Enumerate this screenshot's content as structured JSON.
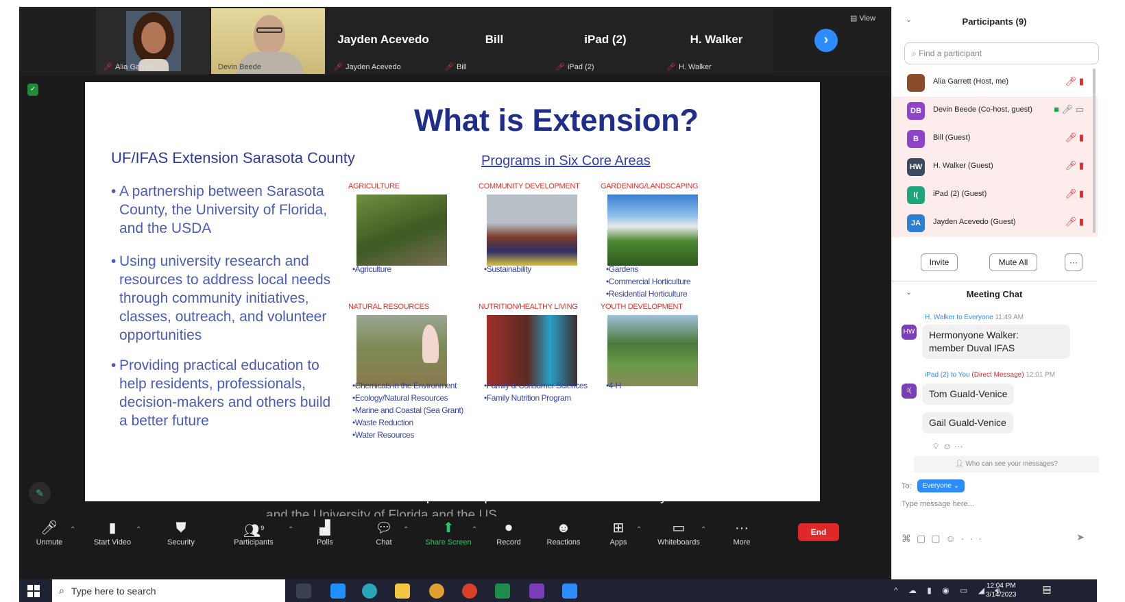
{
  "strip": {
    "tiles": [
      {
        "label": "Alia Garrett",
        "name": ""
      },
      {
        "label": "Devin Beede",
        "name": ""
      },
      {
        "label": "Jayden Acevedo",
        "name": "Jayden Acevedo"
      },
      {
        "label": "Bill",
        "name": "Bill"
      },
      {
        "label": "iPad (2)",
        "name": "iPad (2)"
      },
      {
        "label": "H. Walker",
        "name": "H. Walker"
      }
    ],
    "view_label": "View"
  },
  "slide": {
    "title": "What is Extension?",
    "subtitle": "UF/IFAS Extension Sarasota County",
    "programs_link": "Programs in Six Core Areas",
    "bullets": [
      "A partnership between Sarasota County, the University of Florida, and the USDA",
      "Using university research and resources to address local needs through community initiatives, classes, outreach, and volunteer opportunities",
      "Providing practical education to help residents, professionals, decision-makers and others build a better future"
    ],
    "areas": [
      {
        "heading": "AGRICULTURE",
        "items": "•Agriculture"
      },
      {
        "heading": "COMMUNITY DEVELOPMENT",
        "items": "•Sustainability"
      },
      {
        "heading": "GARDENING/LANDSCAPING",
        "items": "•Gardens\n•Commercial Horticulture\n•Residential Horticulture"
      },
      {
        "heading": "NATURAL RESOURCES",
        "items": "•Chemicals in the Environment\n•Ecology/Natural Resources\n•Marine and Coastal (Sea Grant)\n•Waste Reduction\n•Water Resources"
      },
      {
        "heading": "NUTRITION/HEALTHY LIVING",
        "items": "•Family & Consumer Sciences\n•Family Nutrition Program"
      },
      {
        "heading": "YOUTH DEVELOPMENT",
        "items": "•4-H"
      }
    ]
  },
  "caption": {
    "line1": "What is extension? So our extension office is a partnership between the Sarasota County",
    "line2": "and the University of Florida and the US"
  },
  "toolbar": {
    "unmute": "Unmute",
    "start_video": "Start Video",
    "security": "Security",
    "participants": "Participants",
    "participants_count": "9",
    "polls": "Polls",
    "chat": "Chat",
    "share_screen": "Share Screen",
    "record": "Record",
    "reactions": "Reactions",
    "apps": "Apps",
    "whiteboards": "Whiteboards",
    "more": "More",
    "end": "End"
  },
  "participants_panel": {
    "title": "Participants (9)",
    "search_placeholder": "Find a participant",
    "rows": [
      {
        "initials": "",
        "name": "Alia Garrett (Host, me)",
        "color": "#8a4b2a"
      },
      {
        "initials": "DB",
        "name": "Devin Beede (Co-host, guest)",
        "color": "#8e44c9"
      },
      {
        "initials": "B",
        "name": "Bill (Guest)",
        "color": "#8e44c9"
      },
      {
        "initials": "HW",
        "name": "H. Walker (Guest)",
        "color": "#3b4a5e"
      },
      {
        "initials": "I(",
        "name": "iPad (2) (Guest)",
        "color": "#1fa57a"
      },
      {
        "initials": "JA",
        "name": "Jayden Acevedo (Guest)",
        "color": "#2d7fd3"
      }
    ],
    "invite": "Invite",
    "mute_all": "Mute All",
    "more": "···"
  },
  "chat": {
    "title": "Meeting Chat",
    "messages": [
      {
        "avatar": "HW",
        "meta_from": "H. Walker to Everyone",
        "meta_dm": "",
        "time": "11:49 AM",
        "text": "Hermonyone Walker:\nmember Duval IFAS"
      },
      {
        "avatar": "I(",
        "meta_from": "iPad (2) to You",
        "meta_dm": "(Direct Message)",
        "time": "12:01 PM",
        "text": "Tom Guald-Venice"
      }
    ],
    "followup": "Gail Guald-Venice",
    "who_can_see": "Who can see your messages?",
    "to_label": "To:",
    "to_value": "Everyone ⌄",
    "input_placeholder": "Type message here..."
  },
  "taskbar": {
    "search_placeholder": "Type here to search",
    "time": "12:04 PM",
    "date": "3/14/2023"
  }
}
